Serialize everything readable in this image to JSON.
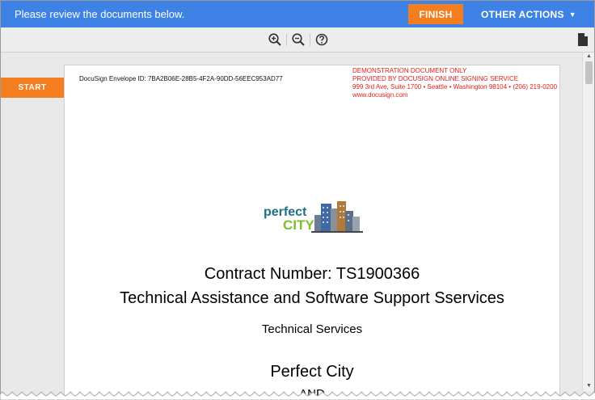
{
  "topbar": {
    "message": "Please review the documents below.",
    "finish_label": "FINISH",
    "other_actions_label": "OTHER ACTIONS",
    "caret": "▼"
  },
  "toolbar": {
    "zoom_in_icon": "zoom-in-icon",
    "zoom_out_icon": "zoom-out-icon",
    "help_icon": "help-icon",
    "document_icon": "document-icon"
  },
  "viewer": {
    "start_label": "START"
  },
  "document": {
    "envelope_id": "DocuSign Envelope ID: 7BA2B06E-28B5-4F2A-90DD-56EEC953AD77",
    "demo_notice": [
      "DEMONSTRATION DOCUMENT ONLY",
      "PROVIDED BY DOCUSIGN ONLINE SIGNING SERVICE",
      "999 3rd Ave, Suite 1700  • Seattle • Washington 98104 • (206) 219-0200",
      "www.docusign.com"
    ],
    "logo": {
      "word1": "perfect",
      "word2": "CITY"
    },
    "contract_number": "Contract Number: TS1900366",
    "subtitle": "Technical Assistance and Software Support Sservices",
    "services": "Technical Services",
    "party": "Perfect City",
    "and": "AND"
  },
  "colors": {
    "topbar": "#3e82e6",
    "accent_orange": "#f47d20",
    "demo_red": "#e0201f",
    "logo_teal": "#1f6f86",
    "logo_green": "#7bbf2a"
  }
}
